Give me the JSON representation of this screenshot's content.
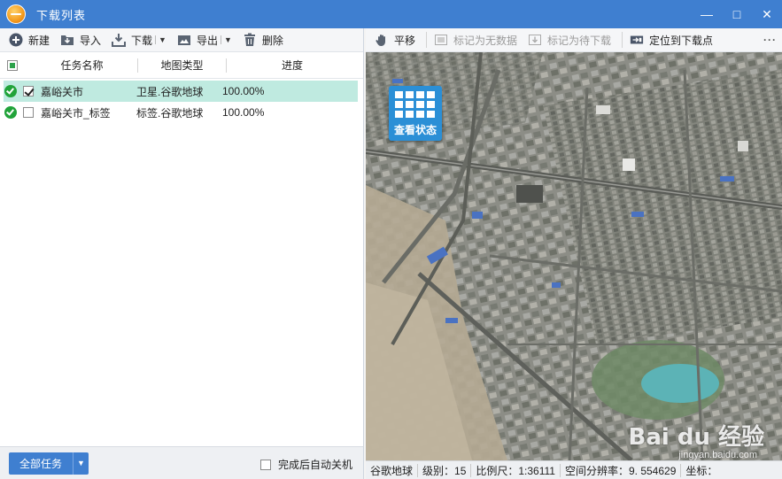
{
  "window": {
    "title": "下载列表",
    "minimize": "—",
    "maximize": "□",
    "close": "✕"
  },
  "left_toolbar": {
    "new_label": "新建",
    "import_label": "导入",
    "download_label": "下载",
    "export_label": "导出",
    "delete_label": "删除"
  },
  "table": {
    "headers": {
      "name": "任务名称",
      "type": "地图类型",
      "progress": "进度"
    },
    "rows": [
      {
        "name": "嘉峪关市",
        "type": "卫星.谷歌地球",
        "progress": "100.00%",
        "checked": true,
        "selected": true
      },
      {
        "name": "嘉峪关市_标签",
        "type": "标签.谷歌地球",
        "progress": "100.00%",
        "checked": false,
        "selected": false
      }
    ]
  },
  "left_footer": {
    "all_tasks_label": "全部任务",
    "auto_shutdown_label": "完成后自动关机"
  },
  "right_toolbar": {
    "pan_label": "平移",
    "mark_nodata_label": "标记为无数据",
    "mark_pending_label": "标记为待下载",
    "locate_label": "定位到下载点",
    "more_label": "···"
  },
  "map": {
    "status_button_label": "查看状态",
    "watermark_brand": "Bai du 经验",
    "watermark_url": "jingyan.baidu.com"
  },
  "status_bar": {
    "source": "谷歌地球",
    "level": "级别：15",
    "scale": "比例尺：1:36111",
    "resolution": "空间分辨率：9. 554629",
    "coord": "坐标："
  },
  "colors": {
    "accent": "#3f7fd0",
    "selected_row": "#bfeae0",
    "ok_green": "#21a33a"
  }
}
